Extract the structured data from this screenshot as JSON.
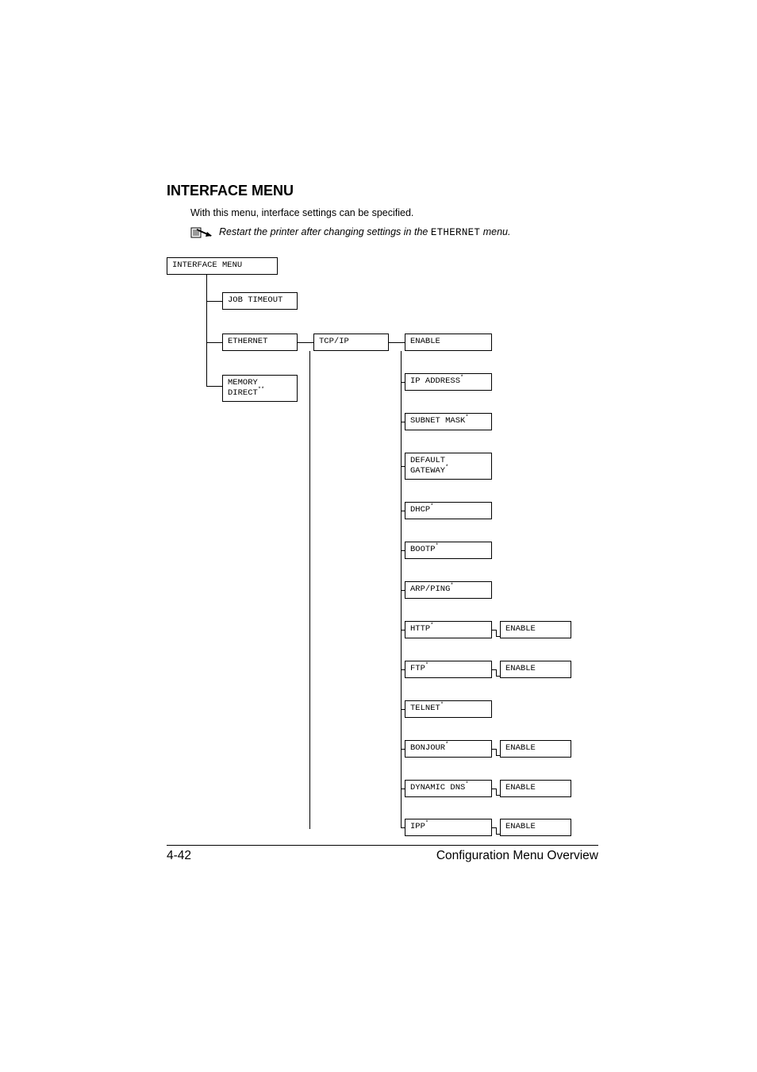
{
  "heading": "INTERFACE MENU",
  "intro_text": "With this menu, interface settings can be specified.",
  "note_text_prefix": "Restart the printer after changing settings in the ",
  "note_mono": "ETHERNET",
  "note_text_suffix": " menu.",
  "diagram": {
    "root": "INTERFACE MENU",
    "job_timeout": "JOB TIMEOUT",
    "ethernet": "ETHERNET",
    "memory_direct_l1": "MEMORY",
    "memory_direct_l2": "DIRECT",
    "memory_direct_sup": "**",
    "tcpip": "TCP/IP",
    "enable": "ENABLE",
    "ip_address": "IP ADDRESS",
    "subnet_mask": "SUBNET MASK",
    "default_gateway_l1": "DEFAULT",
    "default_gateway_l2": "GATEWAY",
    "dhcp": "DHCP",
    "bootp": "BOOTP",
    "arp_ping": "ARP/PING",
    "http": "HTTP",
    "ftp": "FTP",
    "telnet": "TELNET",
    "bonjour": "BONJOUR",
    "dynamic_dns": "DYNAMIC DNS",
    "ipp": "IPP",
    "star": "*"
  },
  "footer": {
    "page": "4-42",
    "title": "Configuration Menu Overview"
  }
}
